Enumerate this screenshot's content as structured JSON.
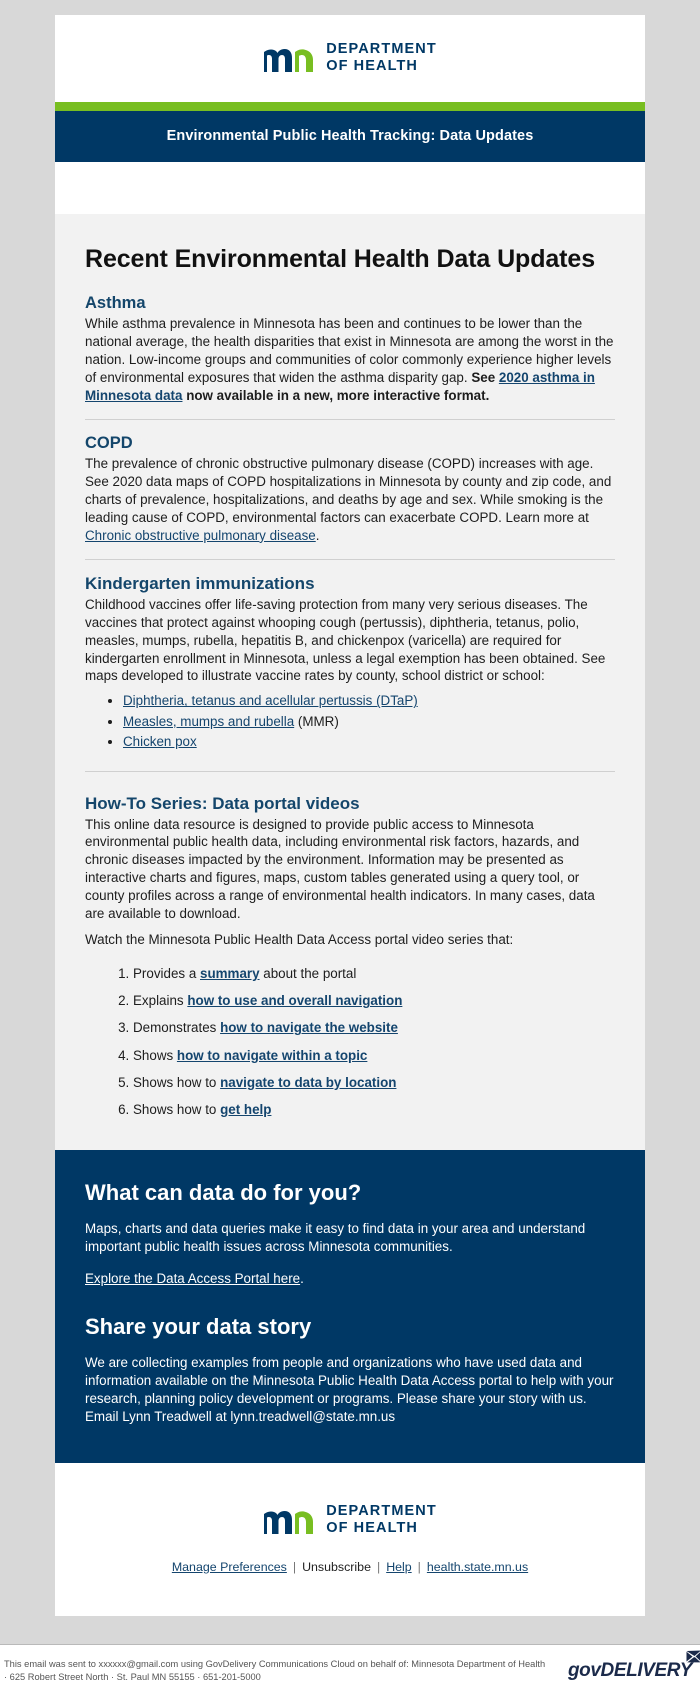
{
  "brand": {
    "logo_alt": "mn-department-of-health-logo",
    "logo_line1": "DEPARTMENT",
    "logo_line2": "OF HEALTH",
    "navy": "#003865",
    "green": "#78be21",
    "link_blue": "#14456e"
  },
  "header": {
    "title_bar": "Environmental Public Health Tracking: Data Updates"
  },
  "main": {
    "title": "Recent Environmental Health Data Updates",
    "sections": [
      {
        "heading": "Asthma",
        "text_1": "While asthma prevalence in Minnesota has been and continues to be lower than the national average, the health disparities that exist in Minnesota are among the worst in the nation. Low-income groups and communities of color commonly experience higher levels of environmental exposures that widen the asthma disparity gap. ",
        "bold_see": "See ",
        "link": "2020 asthma in Minnesota data",
        "text_2": " now available in a new, more interactive format."
      },
      {
        "heading": "COPD",
        "text_1": "The prevalence of chronic obstructive pulmonary disease (COPD) increases with age. See 2020 data maps of COPD hospitalizations in Minnesota by county and zip code, and charts of prevalence, hospitalizations, and deaths by age and sex. While smoking is the leading cause of COPD, environmental factors can exacerbate COPD. Learn more at ",
        "link": "Chronic obstructive pulmonary disease",
        "text_2": "."
      },
      {
        "heading": "Kindergarten immunizations",
        "text_1": "Childhood vaccines offer life-saving protection from many very serious diseases. The vaccines that protect against whooping cough (pertussis), diphtheria, tetanus, polio, measles, mumps, rubella, hepatitis B, and chickenpox (varicella) are required for kindergarten enrollment in Minnesota, unless a legal exemption has been obtained. See maps developed to illustrate vaccine rates by county, school district or school:",
        "bullets": [
          {
            "link": "Diphtheria, tetanus and acellular pertussis (DTaP)",
            "tail": ""
          },
          {
            "link": "Measles, mumps and rubella",
            "tail": " (MMR)"
          },
          {
            "link": "Chicken pox",
            "tail": ""
          }
        ]
      }
    ],
    "howto": {
      "heading": "How-To Series: Data portal videos",
      "paragraph_1": "This online data resource is designed to provide public access to Minnesota environmental public health data, including environmental risk factors, hazards, and chronic diseases impacted by the environment. Information may be presented as interactive charts and figures, maps, custom tables generated using a query tool, or county profiles across a range of environmental health indicators. In many cases, data are available to download.",
      "paragraph_2": "Watch the Minnesota Public Health Data Access portal video series that:",
      "items": [
        {
          "pre": "Provides a ",
          "link": "summary",
          "post": " about the portal"
        },
        {
          "pre": "Explains ",
          "link": "how to use and overall navigation",
          "post": ""
        },
        {
          "pre": "Demonstrates ",
          "link": "how to navigate the website",
          "post": ""
        },
        {
          "pre": "Shows ",
          "link": "how to navigate within a topic",
          "post": ""
        },
        {
          "pre": "Shows how to ",
          "link": "navigate to data by location",
          "post": ""
        },
        {
          "pre": "Shows how to ",
          "link": "get help",
          "post": ""
        }
      ]
    }
  },
  "cta": {
    "heading_1": "What can data do for you?",
    "paragraph_1": "Maps, charts and data queries make it easy to find data in your area and understand important public health issues across Minnesota communities.",
    "link": "Explore the Data Access Portal here",
    "link_tail": ".",
    "heading_2": "Share your data story",
    "paragraph_2": "We are collecting examples from people and organizations who have used data and information available on the Minnesota Public Health Data Access portal to help with your research, planning policy development or programs. Please share your story with us. Email Lynn Treadwell at lynn.treadwell@state.mn.us"
  },
  "footer": {
    "links": [
      {
        "label": "Manage Preferences",
        "is_link": true
      },
      {
        "label": "Unsubscribe",
        "is_link": false
      },
      {
        "label": "Help",
        "is_link": true
      },
      {
        "label": "health.state.mn.us",
        "is_link": true
      }
    ],
    "separator": "|"
  },
  "bottom": {
    "sent_line_1": "This email was sent to xxxxxx@gmail.com using GovDelivery Communications Cloud on behalf of: Minnesota Department of Health",
    "sent_line_2": "· 625 Robert Street North · St. Paul MN 55155 · 651-201-5000",
    "govdelivery_word": "govDELIVERY",
    "govdelivery_mark": "envelope-icon"
  }
}
